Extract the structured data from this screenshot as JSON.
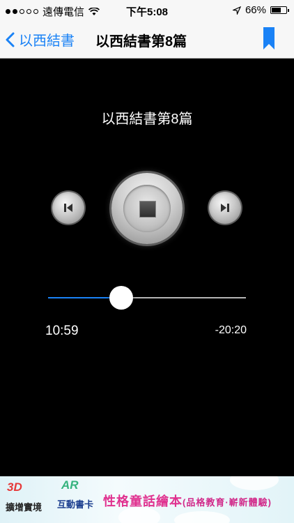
{
  "status_bar": {
    "carrier": "遠傳電信",
    "time": "下午5:08",
    "battery": "66%",
    "battery_level": 0.66,
    "signal_bars_filled": 2,
    "signal_bars_total": 5
  },
  "nav": {
    "back_label": "以西結書",
    "title": "以西結書第8篇",
    "accent": "#1a82f6"
  },
  "player": {
    "track_title": "以西結書第8篇",
    "elapsed": "10:59",
    "remaining": "-20:20",
    "progress": 0.37
  },
  "ad": {
    "badge_3d": "3D",
    "badge_3d_text": "擴增實境",
    "badge_ar": "AR",
    "badge_ar_text": "互動書卡",
    "headline": "性格童話繪本",
    "tagline": "(品格教育·嶄新體驗)"
  }
}
